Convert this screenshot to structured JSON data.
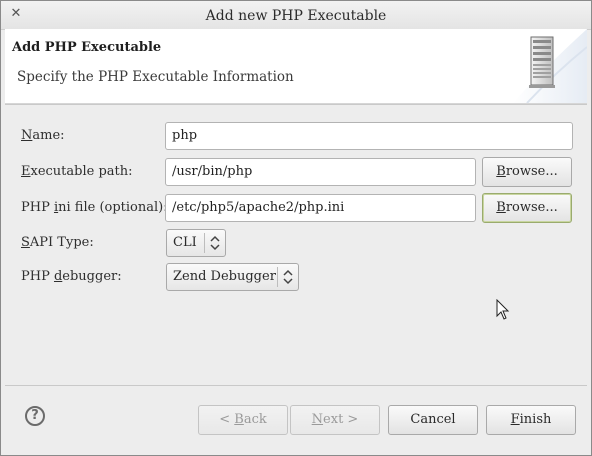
{
  "window": {
    "title": "Add new PHP Executable"
  },
  "banner": {
    "title": "Add PHP Executable",
    "subtitle": "Specify the PHP Executable Information"
  },
  "form": {
    "name": {
      "label_mnemonic": "N",
      "label_rest": "ame:",
      "value": "php"
    },
    "exec_path": {
      "label_mnemonic": "E",
      "label_rest": "xecutable path:",
      "value": "/usr/bin/php"
    },
    "ini_file": {
      "label_pre": "PHP ",
      "label_mnemonic": "i",
      "label_rest": "ni file (optional):",
      "value": "/etc/php5/apache2/php.ini"
    },
    "sapi": {
      "label_mnemonic": "S",
      "label_rest": "API Type:",
      "value": "CLI"
    },
    "debugger": {
      "label_pre": "PHP ",
      "label_mnemonic": "d",
      "label_rest": "ebugger:",
      "value": "Zend Debugger"
    },
    "browse": {
      "mnemonic": "B",
      "rest": "rowse..."
    }
  },
  "buttons": {
    "back": {
      "pre": "< ",
      "mnemonic": "B",
      "rest": "ack"
    },
    "next": {
      "mnemonic": "N",
      "rest": "ext >"
    },
    "cancel": "Cancel",
    "finish": {
      "mnemonic": "F",
      "rest": "inish"
    }
  },
  "help": "?",
  "icons": {
    "close": "close-icon",
    "server": "server-icon",
    "help": "help-icon",
    "cursor": "mouse-pointer-icon",
    "updown": "up-down-arrows-icon"
  },
  "colors": {
    "focus_border": "#9aab6e",
    "banner_bg": "#ffffff",
    "dialog_bg": "#ededed"
  }
}
